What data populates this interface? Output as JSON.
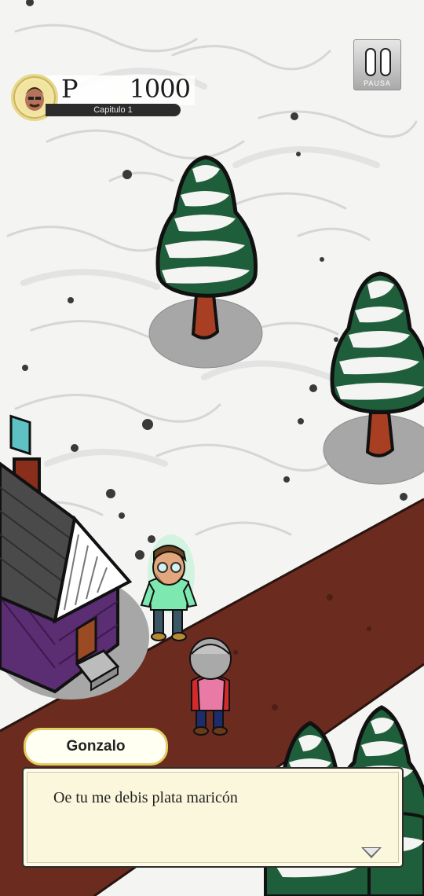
{
  "hud": {
    "points_prefix": "P",
    "points": "1000",
    "chapter": "Capitulo 1",
    "avatar_icon": "player-portrait-icon"
  },
  "pause_button": {
    "label": "PAUSA",
    "icon": "pause-icon"
  },
  "dialog": {
    "speaker": "Gonzalo",
    "text": "Oe tu me debis plata maricón",
    "continue_icon": "down-triangle-icon"
  },
  "colors": {
    "snow": "#f4f4f2",
    "road": "#6b2b1f",
    "tree_green": "#1f5e3b",
    "cabin_purple": "#5b2d72",
    "name_tag_border": "#e3cf5d",
    "dialog_background": "#fbf7dc"
  }
}
